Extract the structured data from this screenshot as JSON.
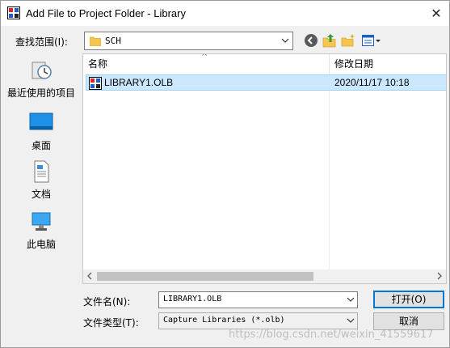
{
  "window": {
    "title": "Add File to Project Folder - Library",
    "close_glyph": "✕"
  },
  "lookin": {
    "label": "查找范围(I):",
    "value": "SCH",
    "arrow": "⌄"
  },
  "places": [
    {
      "label": "最近使用的项目",
      "icon": "recent-places-icon"
    },
    {
      "label": "桌面",
      "icon": "desktop-icon"
    },
    {
      "label": "文档",
      "icon": "documents-icon"
    },
    {
      "label": "此电脑",
      "icon": "this-pc-icon"
    }
  ],
  "filelist": {
    "columns": [
      "名称",
      "修改日期"
    ],
    "sort_glyph": "^",
    "rows": [
      {
        "name": "LIBRARY1.OLB",
        "date": "2020/11/17 10:18"
      }
    ]
  },
  "filename": {
    "label": "文件名(N):",
    "value": "LIBRARY1.OLB"
  },
  "filetype": {
    "label": "文件类型(T):",
    "value": "Capture Libraries (*.olb)"
  },
  "buttons": {
    "open": "打开(O)",
    "cancel": "取消"
  },
  "watermark": "https://blog.csdn.net/weixin_41559617",
  "colors": {
    "selection": "#cce8ff",
    "selection_border": "#99d1ff",
    "primary_border": "#0078d7"
  }
}
